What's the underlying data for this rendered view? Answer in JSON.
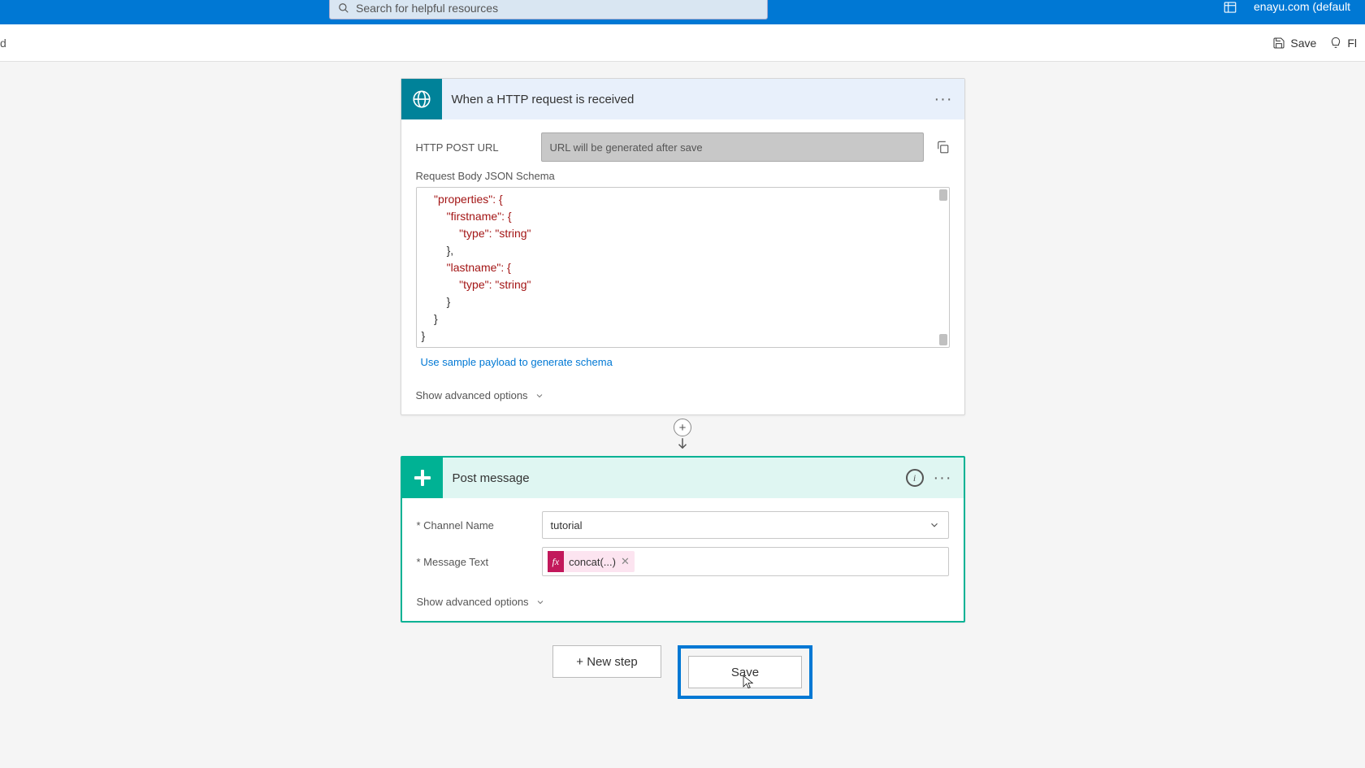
{
  "top": {
    "search_placeholder": "Search for helpful resources",
    "org": "enayu.com (default"
  },
  "subbar": {
    "left": "d",
    "save": "Save",
    "flow": "Fl"
  },
  "trigger": {
    "title": "When a HTTP request is received",
    "url_label": "HTTP POST URL",
    "url_value": "URL will be generated after save",
    "schema_label": "Request Body JSON Schema",
    "sample_link": "Use sample payload to generate schema",
    "adv": "Show advanced options",
    "code": {
      "l1": "    \"properties\": {",
      "l2": "        \"firstname\": {",
      "l3": "            \"type\": \"string\"",
      "l4": "        },",
      "l5": "        \"lastname\": {",
      "l6": "            \"type\": \"string\"",
      "l7": "        }",
      "l8": "    }",
      "l9": "}"
    }
  },
  "action": {
    "title": "Post message",
    "channel_label": "Channel Name",
    "channel_value": "tutorial",
    "msg_label": "Message Text",
    "token_fx": "fx",
    "token_text": "concat(...)",
    "adv": "Show advanced options"
  },
  "buttons": {
    "newstep": "+ New step",
    "save": "Save"
  }
}
